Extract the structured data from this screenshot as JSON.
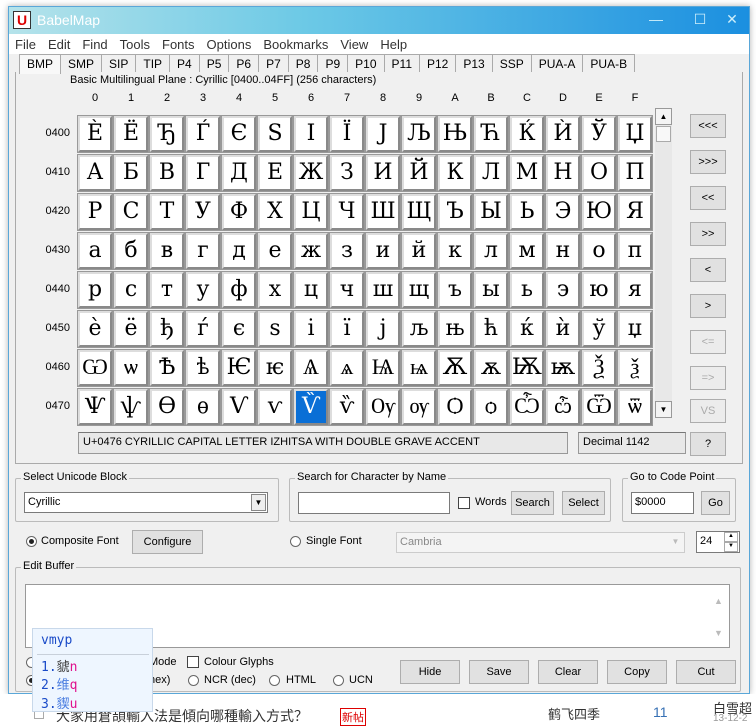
{
  "window": {
    "title": "BabelMap",
    "app_icon": "U",
    "controls": [
      "minimize-icon",
      "maximize-icon",
      "close-icon"
    ]
  },
  "menu": [
    "File",
    "Edit",
    "Find",
    "Tools",
    "Fonts",
    "Options",
    "Bookmarks",
    "View",
    "Help"
  ],
  "tabs": [
    "BMP",
    "SMP",
    "SIP",
    "TIP",
    "P4",
    "P5",
    "P6",
    "P7",
    "P8",
    "P9",
    "P10",
    "P11",
    "P12",
    "P13",
    "SSP",
    "PUA-A",
    "PUA-B"
  ],
  "active_tab": "BMP",
  "grid": {
    "block_info": "Basic Multilingual Plane : Cyrillic [0400..04FF] (256 characters)",
    "columns": [
      "0",
      "1",
      "2",
      "3",
      "4",
      "5",
      "6",
      "7",
      "8",
      "9",
      "A",
      "B",
      "C",
      "D",
      "E",
      "F"
    ],
    "rows": [
      {
        "label": "0400",
        "chars": [
          "Ѐ",
          "Ё",
          "Ђ",
          "Ѓ",
          "Є",
          "Ѕ",
          "І",
          "Ї",
          "Ј",
          "Љ",
          "Њ",
          "Ћ",
          "Ќ",
          "Ѝ",
          "Ў",
          "Џ"
        ]
      },
      {
        "label": "0410",
        "chars": [
          "А",
          "Б",
          "В",
          "Г",
          "Д",
          "Е",
          "Ж",
          "З",
          "И",
          "Й",
          "К",
          "Л",
          "М",
          "Н",
          "О",
          "П"
        ]
      },
      {
        "label": "0420",
        "chars": [
          "Р",
          "С",
          "Т",
          "У",
          "Ф",
          "Х",
          "Ц",
          "Ч",
          "Ш",
          "Щ",
          "Ъ",
          "Ы",
          "Ь",
          "Э",
          "Ю",
          "Я"
        ]
      },
      {
        "label": "0430",
        "chars": [
          "а",
          "б",
          "в",
          "г",
          "д",
          "е",
          "ж",
          "з",
          "и",
          "й",
          "к",
          "л",
          "м",
          "н",
          "о",
          "п"
        ]
      },
      {
        "label": "0440",
        "chars": [
          "р",
          "с",
          "т",
          "у",
          "ф",
          "х",
          "ц",
          "ч",
          "ш",
          "щ",
          "ъ",
          "ы",
          "ь",
          "э",
          "ю",
          "я"
        ]
      },
      {
        "label": "0450",
        "chars": [
          "ѐ",
          "ё",
          "ђ",
          "ѓ",
          "є",
          "ѕ",
          "і",
          "ї",
          "ј",
          "љ",
          "њ",
          "ћ",
          "ќ",
          "ѝ",
          "ў",
          "џ"
        ]
      },
      {
        "label": "0460",
        "chars": [
          "Ѡ",
          "ѡ",
          "Ѣ",
          "ѣ",
          "Ѥ",
          "ѥ",
          "Ѧ",
          "ѧ",
          "Ѩ",
          "ѩ",
          "Ѫ",
          "ѫ",
          "Ѭ",
          "ѭ",
          "Ѯ",
          "ѯ"
        ]
      },
      {
        "label": "0470",
        "chars": [
          "Ѱ",
          "ѱ",
          "Ѳ",
          "ѳ",
          "Ѵ",
          "ѵ",
          "Ѷ",
          "ѷ",
          "Ѹ",
          "ѹ",
          "Ѻ",
          "ѻ",
          "Ѽ",
          "ѽ",
          "Ѿ",
          "ѿ"
        ]
      }
    ],
    "selected": {
      "row": 7,
      "col": 6
    },
    "selection_color": "#0a6fd6",
    "char_name": "U+0476 CYRILLIC CAPITAL LETTER IZHITSA WITH DOUBLE GRAVE ACCENT",
    "decimal": "Decimal 1142"
  },
  "nav_buttons": [
    {
      "label": "<<<",
      "enabled": true
    },
    {
      "label": ">>>",
      "enabled": true
    },
    {
      "label": "<<",
      "enabled": true
    },
    {
      "label": ">>",
      "enabled": true
    },
    {
      "label": "<",
      "enabled": true
    },
    {
      "label": ">",
      "enabled": true
    },
    {
      "label": "<=",
      "enabled": false
    },
    {
      "label": "=>",
      "enabled": false
    },
    {
      "label": "VS",
      "enabled": false
    },
    {
      "label": "?",
      "enabled": true
    }
  ],
  "block_select": {
    "label": "Select Unicode Block",
    "value": "Cyrillic"
  },
  "search": {
    "label": "Search for Character by Name",
    "value": "",
    "words_label": "Words",
    "words_checked": false,
    "search_btn": "Search",
    "select_btn": "Select"
  },
  "goto": {
    "label": "Go to Code Point",
    "value": "$0000",
    "go_btn": "Go"
  },
  "font": {
    "composite_label": "Composite Font",
    "configure_btn": "Configure",
    "single_label": "Single Font",
    "single_value": "Cambria",
    "size": "24",
    "composite_selected": true
  },
  "edit_buffer": {
    "label": "Edit Buffer",
    "value": "",
    "mode_label_partial": "Mode",
    "colour_glyphs": "Colour Glyphs",
    "hex_label_partial": "hex)",
    "ncr_dec": "NCR (dec)",
    "html": "HTML",
    "ucn": "UCN",
    "buttons": [
      "Hide",
      "Save",
      "Clear",
      "Copy",
      "Cut"
    ]
  },
  "ime": {
    "input": "vmyp",
    "candidates": [
      {
        "num": "1.",
        "char": "䝞",
        "key": "n"
      },
      {
        "num": "2.",
        "char": "维",
        "key": "q"
      },
      {
        "num": "3.",
        "char": "䝟",
        "key": "u"
      }
    ]
  },
  "background_page": {
    "topic": "大家用倉頡輸入法是傾向哪種輸入方式？",
    "badge": "新帖",
    "author": "鹤飞四季",
    "replies": "11",
    "last_poster": "白雪超",
    "last_date": "13-12-2"
  }
}
